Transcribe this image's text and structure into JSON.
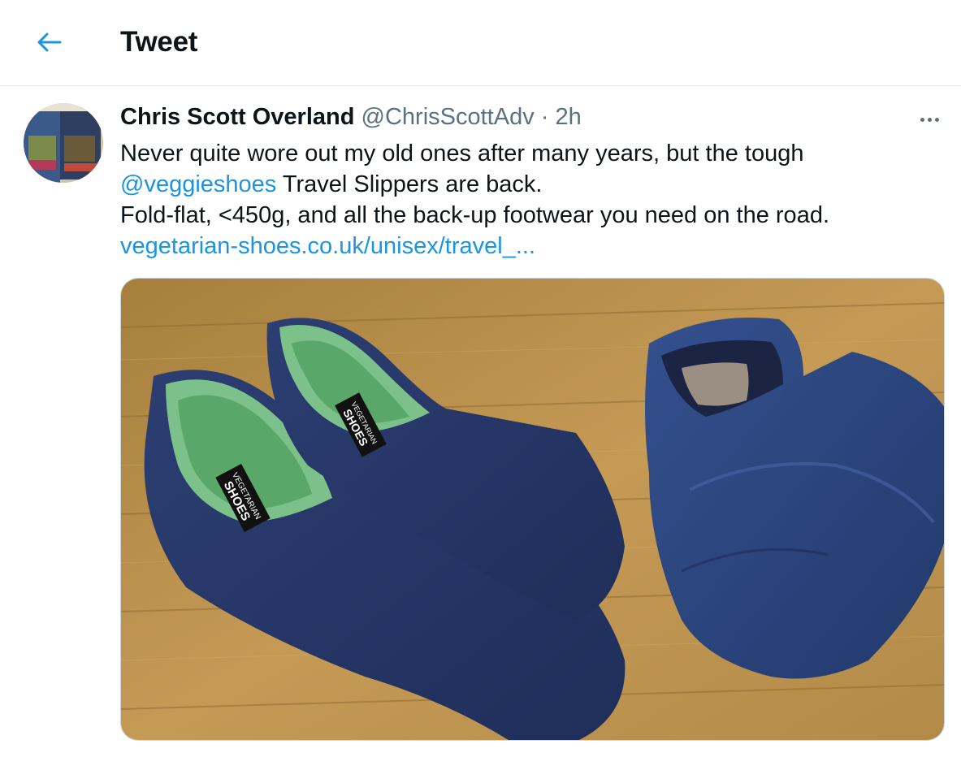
{
  "header": {
    "title": "Tweet",
    "back_icon": "arrow-left-icon"
  },
  "tweet": {
    "author_name": "Chris Scott Overland",
    "handle": "@ChrisScottAdv",
    "separator": "·",
    "time": "2h",
    "more_icon": "more-horizontal-icon",
    "text": {
      "line1": "Never quite wore out my old ones after many years, but the tough",
      "mention": "@veggieshoes",
      "line2_rest": " Travel Slippers are back.",
      "line3": "Fold-flat, <450g, and all the back-up footwear you need on the road.",
      "url": "vegetarian-shoes.co.uk/unisex/travel_..."
    },
    "media": {
      "label_brand_top": "VEGETARIAN",
      "label_brand_bottom": "SHOES"
    }
  },
  "colors": {
    "link": "#1b95e0",
    "text": "#0f1419",
    "secondary": "#5b7083",
    "divider": "#e6ecf0"
  }
}
